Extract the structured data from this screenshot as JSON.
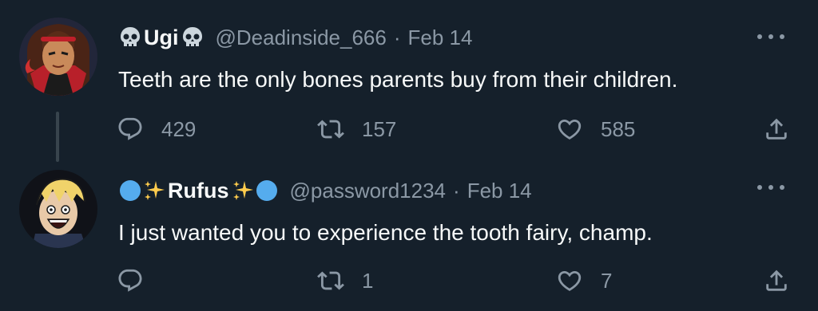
{
  "tweets": [
    {
      "display_name": "Ugi",
      "name_prefix_emoji": "skull-emoji",
      "name_suffix_emoji": "skull-emoji",
      "handle": "@Deadinside_666",
      "separator": "·",
      "date": "Feb 14",
      "text": "Teeth are the only bones parents buy from their children.",
      "reply_count": "429",
      "retweet_count": "157",
      "like_count": "585",
      "has_thread_line": true
    },
    {
      "display_name": "Rufus",
      "name_prefix_emoji": "blue-circle-sparkles-emoji",
      "name_suffix_emoji": "sparkles-blue-circle-emoji",
      "handle": "@password1234",
      "separator": "·",
      "date": "Feb 14",
      "text": "I just wanted you to experience the tooth fairy, champ.",
      "reply_count": "",
      "retweet_count": "1",
      "like_count": "7",
      "has_thread_line": false
    }
  ],
  "icons": {
    "reply": "reply-icon",
    "retweet": "retweet-icon",
    "like": "heart-icon",
    "share": "share-icon",
    "more": "more-options-icon"
  },
  "colors": {
    "background": "#15202b",
    "primary_text": "#f7f9f9",
    "secondary_text": "#8b98a5",
    "thread_line": "#38444d",
    "blue_circle": "#55acee",
    "sparkle": "#ffcc4d"
  }
}
